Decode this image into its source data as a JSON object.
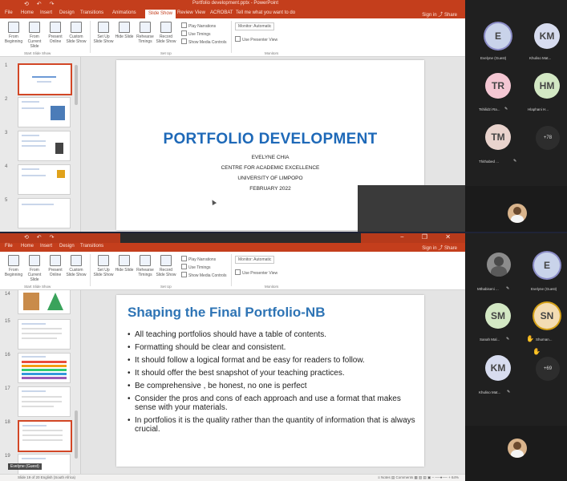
{
  "top": {
    "window_title": "Portfolio development.pptx - PowerPoint",
    "quick_access": "⟲ ↶ ↷",
    "window_controls": "− ❐ ✕",
    "tabs": [
      "File",
      "Home",
      "Insert",
      "Design",
      "Transitions",
      "Animations",
      "Slide Show",
      "Review",
      "View",
      "ACROBAT",
      "Tell me what you want to do"
    ],
    "active_tab_index": 6,
    "account": "Sign in  ⤴ Share",
    "ribbon": {
      "buttons": [
        "From Beginning",
        "From Current Slide",
        "Present Online",
        "Custom Slide Show",
        "Set Up Slide Show",
        "Hide Slide",
        "Rehearse Timings",
        "Record Slide Show"
      ],
      "groups": [
        "Start Slide Show",
        "Set Up",
        "Monitors"
      ],
      "checks": [
        "Play Narrations",
        "Use Timings",
        "Show Media Controls",
        "Use Presenter View"
      ],
      "monitor_label": "Monitor: Automatic"
    },
    "slide_numbers": [
      "1",
      "2",
      "3",
      "4",
      "5"
    ],
    "slide": {
      "title": "PORTFOLIO DEVELOPMENT",
      "author": "EVELYNE CHIA",
      "org": "CENTRE FOR ACADEMIC EXCELLENCE",
      "university": "UNIVERSITY OF LIMPOPO",
      "date": "FEBRUARY 2022"
    },
    "participants": [
      {
        "initials": "E",
        "name": "Evelyne (Guest)",
        "color": "#c9d3ea"
      },
      {
        "initials": "KM",
        "name": "Khuliso Mat...",
        "color": "#d7dcef"
      },
      {
        "initials": "TR",
        "name": "Tshilidzi Ra...",
        "color": "#f4c7d3"
      },
      {
        "initials": "HM",
        "name": "Hlaphani H...",
        "color": "#d3e8c4"
      },
      {
        "initials": "TM",
        "name": "Thithabed ...",
        "color": "#e9d3cd"
      }
    ],
    "more_count": "+78"
  },
  "bottom": {
    "window_controls": "− ❐ ✕",
    "tabs": [
      "File",
      "Home",
      "Insert",
      "Design",
      "Transitions"
    ],
    "account": "Sign in  ⤴ Share",
    "ribbon": {
      "buttons": [
        "From Beginning",
        "From Current Slide",
        "Present Online",
        "Custom Slide Show",
        "Set Up Slide Show",
        "Hide Slide",
        "Rehearse Timings",
        "Record Slide Show"
      ],
      "groups": [
        "Start Slide Show",
        "Set Up",
        "Monitors"
      ],
      "checks": [
        "Play Narrations",
        "Use Timings",
        "Show Media Controls",
        "Use Presenter View"
      ],
      "monitor_label": "Monitor: Automatic"
    },
    "slide_numbers": [
      "14",
      "15",
      "16",
      "17",
      "18",
      "19"
    ],
    "slide": {
      "title": "Shaping the Final Portfolio-NB",
      "bullets": [
        "All teaching portfolios should have a table of contents.",
        "Formatting should be clear and consistent.",
        "It should follow a logical format and be easy for readers to follow.",
        "It should offer the best snapshot of your teaching practices.",
        "Be comprehensive , be honest, no one is perfect",
        "Consider the pros and cons of each approach and use a format that makes sense with your materials.",
        "In portfolios it is the quality rather than the quantity of information that is always crucial."
      ]
    },
    "status_left": "Slide 19 of 20  English (South Africa)",
    "status_right": "≡ Notes  ▤ Comments   ▦  ▥  ▤  ▣   − ──●── +  64%",
    "presenter_tag": "Evelyne (Guest)",
    "participants": [
      {
        "initials": "",
        "name": "Mthabiseni ...",
        "color": "#8c8c8c"
      },
      {
        "initials": "E",
        "name": "Evelyne (Guest)",
        "color": "#c9d3ea"
      },
      {
        "initials": "SM",
        "name": "Sanah Mal...",
        "color": "#d3e8c4"
      },
      {
        "initials": "SN",
        "name": "Shuman...",
        "color": "#f3dcb3"
      },
      {
        "initials": "KM",
        "name": "Khuliso Mat...",
        "color": "#d7dcef"
      }
    ],
    "more_count": "+69"
  }
}
